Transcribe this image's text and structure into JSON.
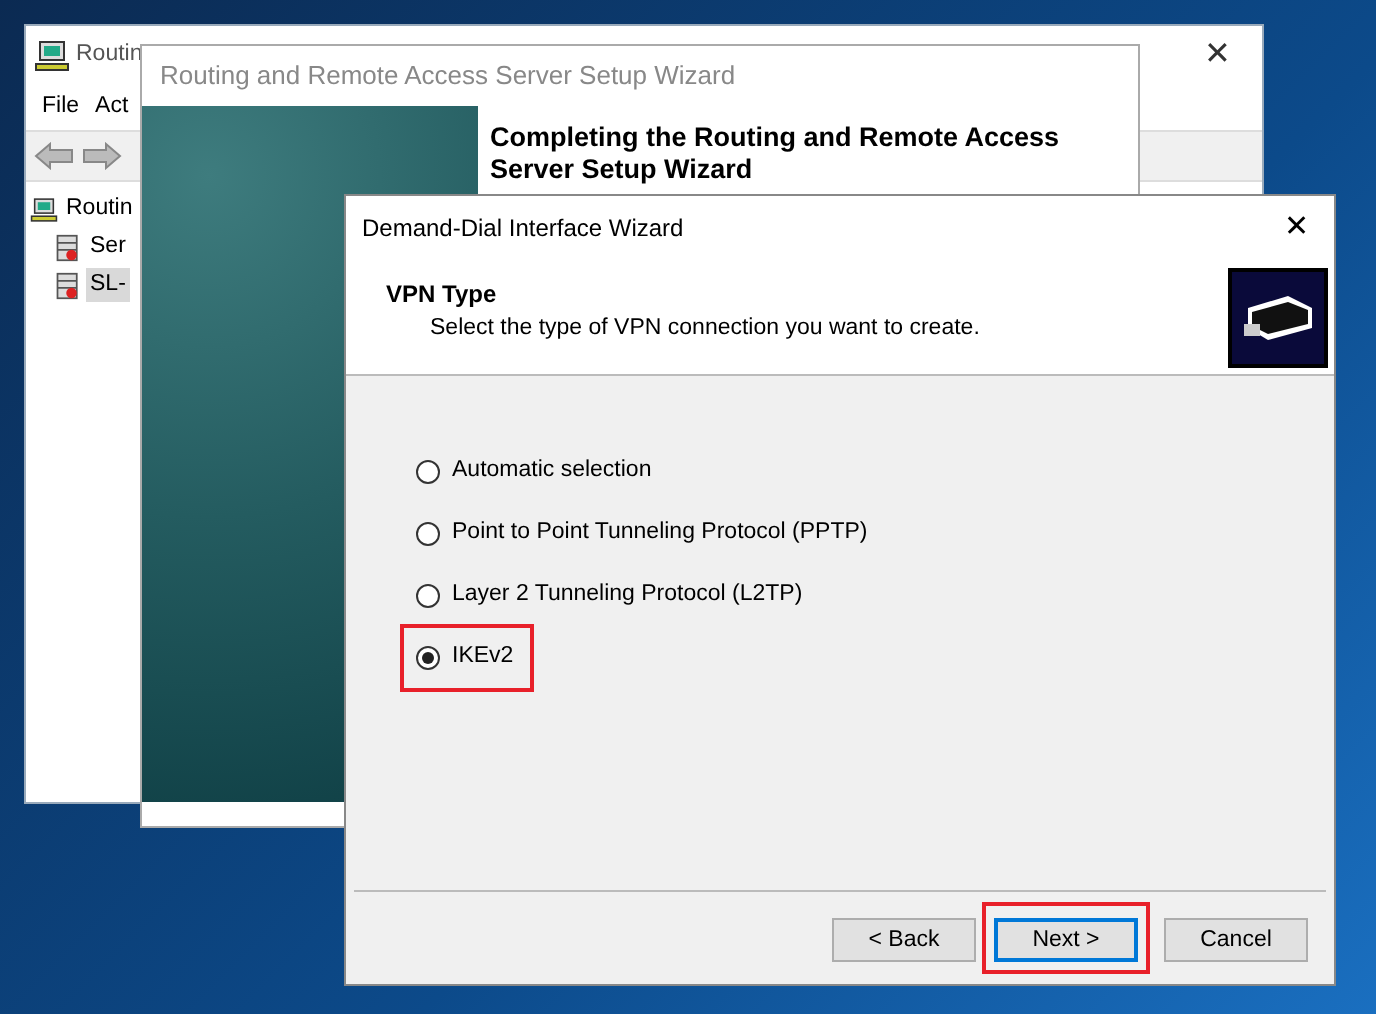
{
  "console_window": {
    "title": "Routin",
    "close_glyph": "✕",
    "menu": [
      "File",
      "Act"
    ],
    "tree": [
      {
        "label": "Routin",
        "selected": false,
        "children": [
          {
            "label": "Ser",
            "selected": false
          },
          {
            "label": "SL-",
            "selected": true
          }
        ]
      }
    ]
  },
  "setup_wizard": {
    "title": "Routing and Remote Access Server Setup Wizard",
    "heading": "Completing the Routing and Remote Access Server Setup Wizard"
  },
  "dialog": {
    "title": "Demand-Dial Interface Wizard",
    "close_glyph": "✕",
    "heading": "VPN Type",
    "subheading": "Select the type of VPN connection you want to create.",
    "options": [
      {
        "label": "Automatic selection",
        "selected": false,
        "highlighted": false
      },
      {
        "label": "Point to Point Tunneling Protocol (PPTP)",
        "selected": false,
        "highlighted": false
      },
      {
        "label": "Layer 2 Tunneling Protocol (L2TP)",
        "selected": false,
        "highlighted": false
      },
      {
        "label": "IKEv2",
        "selected": true,
        "highlighted": true
      }
    ],
    "buttons": [
      {
        "label": "< Back",
        "default": false,
        "highlighted": false
      },
      {
        "label": "Next >",
        "default": true,
        "highlighted": true
      },
      {
        "label": "Cancel",
        "default": false,
        "highlighted": false
      }
    ]
  }
}
